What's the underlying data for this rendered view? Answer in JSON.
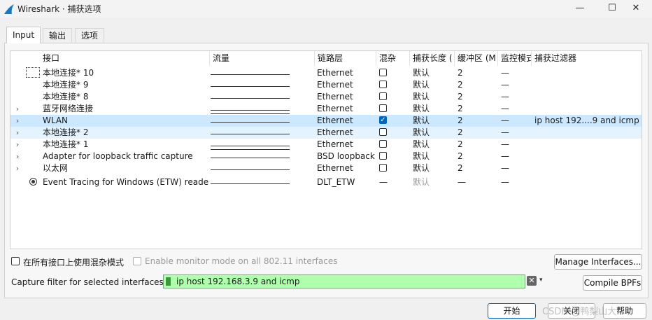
{
  "window": {
    "title": "Wireshark · 捕获选项",
    "minimize": "—",
    "maximize": "☐",
    "close": "✕"
  },
  "tabs": [
    "Input",
    "输出",
    "选项"
  ],
  "table": {
    "columns": [
      "接口",
      "流量",
      "链路层",
      "混杂",
      "捕获长度 (",
      "缓冲区 (M",
      "监控模式",
      "捕获过滤器"
    ],
    "rows": [
      {
        "expander": "",
        "name": "本地连接* 10",
        "link": "Ethernet",
        "promisc": "unchecked",
        "snaplen": "默认",
        "buffer": "2",
        "monitor": "—",
        "filter": "",
        "spark": "single"
      },
      {
        "expander": "",
        "name": "本地连接* 9",
        "link": "Ethernet",
        "promisc": "unchecked",
        "snaplen": "默认",
        "buffer": "2",
        "monitor": "—",
        "filter": "",
        "spark": "single"
      },
      {
        "expander": "",
        "name": "本地连接* 8",
        "link": "Ethernet",
        "promisc": "unchecked",
        "snaplen": "默认",
        "buffer": "2",
        "monitor": "—",
        "filter": "",
        "spark": "single"
      },
      {
        "expander": "›",
        "name": "蓝牙网络连接",
        "link": "Ethernet",
        "promisc": "unchecked",
        "snaplen": "默认",
        "buffer": "2",
        "monitor": "—",
        "filter": "",
        "spark": "double"
      },
      {
        "expander": "›",
        "name": "WLAN",
        "link": "Ethernet",
        "promisc": "checked",
        "snaplen": "默认",
        "buffer": "2",
        "monitor": "—",
        "filter": "ip host 192....9 and icmp",
        "spark": "single"
      },
      {
        "expander": "›",
        "name": "本地连接* 2",
        "link": "Ethernet",
        "promisc": "unchecked",
        "snaplen": "默认",
        "buffer": "2",
        "monitor": "—",
        "filter": "",
        "spark": "single"
      },
      {
        "expander": "›",
        "name": "本地连接* 1",
        "link": "Ethernet",
        "promisc": "unchecked",
        "snaplen": "默认",
        "buffer": "2",
        "monitor": "—",
        "filter": "",
        "spark": "double"
      },
      {
        "expander": "›",
        "name": "Adapter for loopback traffic capture",
        "link": "BSD loopback",
        "promisc": "unchecked",
        "snaplen": "默认",
        "buffer": "2",
        "monitor": "—",
        "filter": "",
        "spark": "single"
      },
      {
        "expander": "›",
        "name": "以太网",
        "link": "Ethernet",
        "promisc": "unchecked",
        "snaplen": "默认",
        "buffer": "2",
        "monitor": "—",
        "filter": "",
        "spark": "single"
      },
      {
        "expander": "",
        "name": "Event Tracing for Windows (ETW) reader",
        "link": "DLT_ETW",
        "promisc": "dash",
        "snaplen": "默认",
        "buffer": "—",
        "monitor": "—",
        "filter": "",
        "spark": "single"
      }
    ]
  },
  "options": {
    "promisc_all": "在所有接口上使用混杂模式",
    "monitor_all": "Enable monitor mode on all 802.11 interfaces",
    "manage_interfaces": "Manage Interfaces...",
    "filter_label": "Capture filter for selected interfaces:",
    "filter_value": "ip host 192.168.3.9 and icmp",
    "compile_bpfs": "Compile BPFs",
    "clear_glyph": "✕",
    "dropdown_glyph": "▾"
  },
  "footer": {
    "start": "开始",
    "close": "关闭",
    "help": "帮助"
  },
  "watermark": "CSDN @鸭梨山大."
}
